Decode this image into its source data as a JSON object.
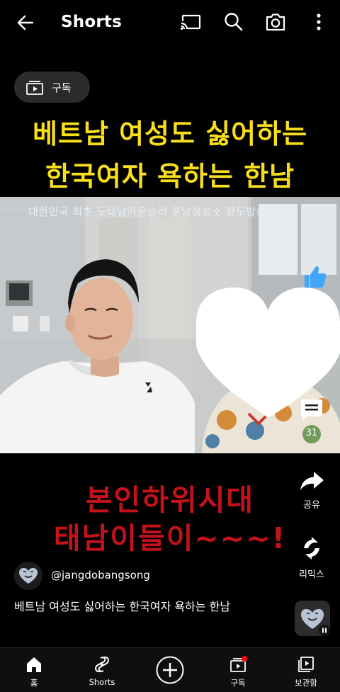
{
  "header": {
    "title": "Shorts"
  },
  "subscribe_chip": {
    "label": "구독"
  },
  "video": {
    "title_line1": "베트남 여성도 싫어하는",
    "title_line2": "한국여자 욕하는 한남",
    "overlay_caption": "대한민국 최초 도태남카운슬러 훈남생성소 장도방송",
    "broadcaster_tag": "roadcaster",
    "red_line1": "본인하위시대",
    "red_line2": "태남이들이~~~!"
  },
  "side_actions": {
    "comments_count": "31",
    "share_label": "공유",
    "remix_label": "리믹스"
  },
  "channel": {
    "handle": "@jangdobangsong"
  },
  "description": "베트남 여성도 싫어하는 한국여자 욕하는 한남",
  "bottom_nav": {
    "home": "홈",
    "shorts": "Shorts",
    "subscriptions": "구독",
    "library": "보관함"
  },
  "icons": {
    "back": "back-arrow-icon",
    "cast": "cast-icon",
    "search": "search-icon",
    "camera": "camera-icon",
    "more": "more-vert-icon",
    "like": "like-icon",
    "comment": "comment-icon",
    "share": "share-icon",
    "remix": "remix-icon",
    "heart": "heart-icon"
  },
  "colors": {
    "title_yellow": "#f7df1c",
    "red_text": "#c4121b",
    "like_blue": "#3ea6ff",
    "notification_dot": "#ff0000"
  }
}
